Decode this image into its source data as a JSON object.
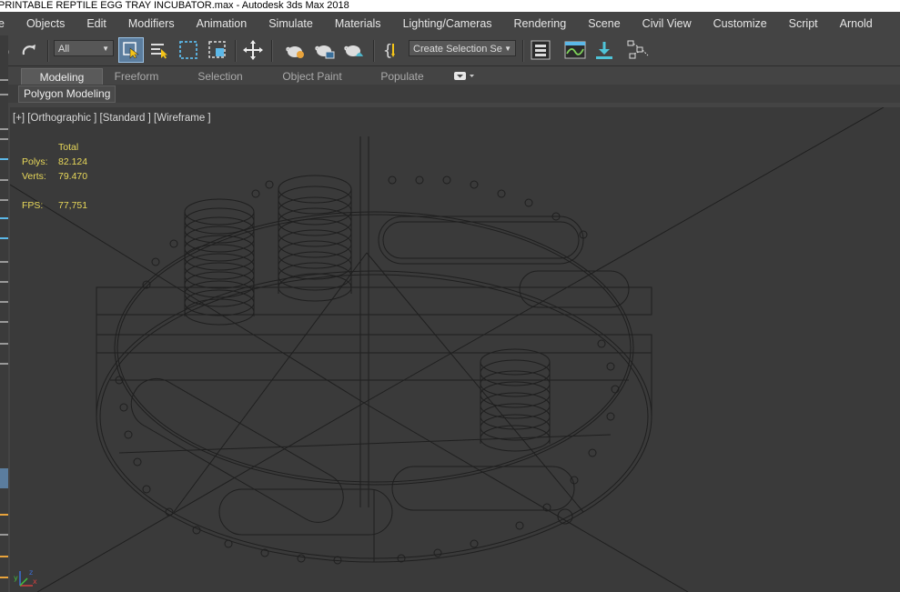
{
  "window": {
    "title": "PRINTABLE REPTILE EGG TRAY INCUBATOR.max - Autodesk 3ds Max 2018"
  },
  "menu": {
    "items": [
      "e",
      "Objects",
      "Edit",
      "Modifiers",
      "Animation",
      "Simulate",
      "Materials",
      "Lighting/Cameras",
      "Rendering",
      "Scene",
      "Civil View",
      "Customize",
      "Script",
      "Arnold"
    ]
  },
  "toolbar": {
    "selection_filter": "All",
    "named_selection_set": "Create Selection Se",
    "icons": [
      "undo-icon",
      "redo-icon",
      "select-object-icon",
      "select-by-name-icon",
      "rectangular-region-icon",
      "window-crossing-icon",
      "select-and-move-icon",
      "render-setup-icon",
      "rendered-frame-window-icon",
      "render-production-icon",
      "edit-named-selection-icon",
      "layer-explorer-icon",
      "curve-editor-icon",
      "toggle-ribbon-icon",
      "schematic-view-icon"
    ]
  },
  "ribbon": {
    "tabs": [
      "Modeling",
      "Freeform",
      "Selection",
      "Object Paint",
      "Populate"
    ],
    "active_tab": "Modeling",
    "panel_label": "Polygon Modeling"
  },
  "viewport": {
    "label": "[+] [Orthographic ] [Standard ] [Wireframe ]",
    "stats": {
      "header": "Total",
      "polys_label": "Polys:",
      "polys_value": "82.124",
      "verts_label": "Verts:",
      "verts_value": "79.470",
      "fps_label": "FPS:",
      "fps_value": "77,751"
    },
    "axis": {
      "x": "x",
      "y": "y",
      "z": "z"
    }
  },
  "colors": {
    "ui_background": "#444444",
    "viewport_background": "#3a3a3a",
    "stats_text": "#e8d85a",
    "wireframe": "#1e1e1e",
    "active_tool": "#5b7d9e"
  }
}
